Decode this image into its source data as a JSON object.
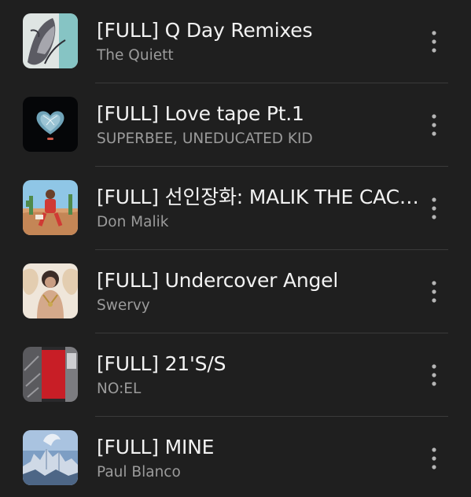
{
  "tracks": [
    {
      "title": "[FULL] Q Day Remixes",
      "artist": "The Quiett",
      "cover_icon": "album-cover-q-day-remixes"
    },
    {
      "title": "[FULL] Love tape Pt.1",
      "artist": "SUPERBEE, UNEDUCATED KID",
      "cover_icon": "album-cover-love-tape"
    },
    {
      "title": "[FULL] 선인장화: MALIK THE CACTUS",
      "artist": "Don Malik",
      "cover_icon": "album-cover-malik-the-cactus"
    },
    {
      "title": "[FULL] Undercover Angel",
      "artist": "Swervy",
      "cover_icon": "album-cover-undercover-angel"
    },
    {
      "title": "[FULL] 21'S/S",
      "artist": "NO:EL",
      "cover_icon": "album-cover-21ss"
    },
    {
      "title": "[FULL] MINE",
      "artist": "Paul Blanco",
      "cover_icon": "album-cover-mine"
    }
  ],
  "more_icon": "more-vertical-icon",
  "colors": {
    "background": "#1f1f1f",
    "title": "#f2f2f2",
    "artist": "#9b9b9b",
    "divider": "#3a3a3a",
    "icon": "#b5b5b5"
  }
}
